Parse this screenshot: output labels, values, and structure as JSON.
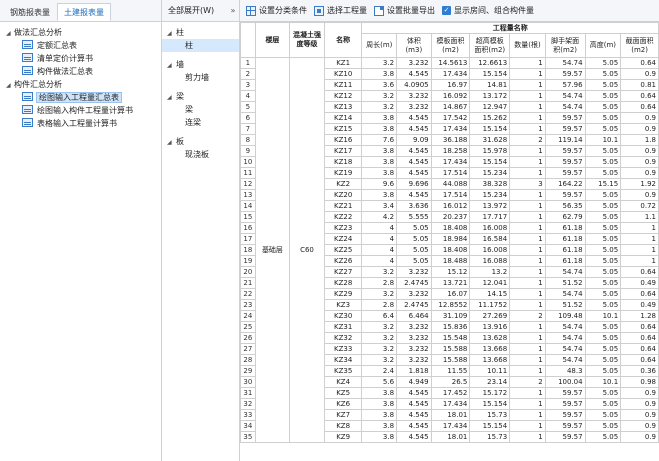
{
  "left_tabs": [
    "钢筋报表量",
    "土建报表量"
  ],
  "left_tree": [
    {
      "label": "做法汇总分析",
      "level": 0,
      "type": "folder"
    },
    {
      "label": "定额汇总表",
      "level": 1,
      "type": "report"
    },
    {
      "label": "清单定价计算书",
      "level": 1,
      "type": "report"
    },
    {
      "label": "构件做法汇总表",
      "level": 1,
      "type": "report"
    },
    {
      "label": "构件汇总分析",
      "level": 0,
      "type": "folder"
    },
    {
      "label": "绘图输入工程量汇总表",
      "level": 1,
      "type": "report",
      "selected": true
    },
    {
      "label": "绘图输入构件工程量计算书",
      "level": 1,
      "type": "report"
    },
    {
      "label": "表格输入工程量计算书",
      "level": 1,
      "type": "report"
    }
  ],
  "mid_header": {
    "dropdown": "全部展开(W)",
    "collapse": "»"
  },
  "mid_tree": [
    {
      "label": "柱",
      "kind": "cat"
    },
    {
      "label": "柱",
      "kind": "leaf",
      "selected": true
    },
    {
      "label": "",
      "kind": "gap"
    },
    {
      "label": "墙",
      "kind": "cat"
    },
    {
      "label": "剪力墙",
      "kind": "leaf"
    },
    {
      "label": "",
      "kind": "gap"
    },
    {
      "label": "梁",
      "kind": "cat"
    },
    {
      "label": "梁",
      "kind": "leaf"
    },
    {
      "label": "连梁",
      "kind": "leaf"
    },
    {
      "label": "",
      "kind": "gap"
    },
    {
      "label": "板",
      "kind": "cat"
    },
    {
      "label": "现浇板",
      "kind": "leaf"
    }
  ],
  "toolbar": {
    "set_category": "设置分类条件",
    "select_quantity": "选择工程量",
    "batch_export": "设置批量导出",
    "show_floor": "显示房间、组合构件量"
  },
  "table": {
    "group_header": "工程量名称",
    "headers": [
      "楼层",
      "混凝土强度等级",
      "名称",
      "周长(m)",
      "体积(m3)",
      "模板面积(m2)",
      "超高模板面积(m2)",
      "数量(根)",
      "脚手架面积(m2)",
      "高度(m)",
      "截面面积(m2)"
    ],
    "floor": "基础层",
    "grade": "C60",
    "rows": [
      [
        "KZ1",
        "3.2",
        "3.232",
        "14.5613",
        "12.6613",
        "1",
        "54.74",
        "5.05",
        "0.64"
      ],
      [
        "KZ10",
        "3.8",
        "4.545",
        "17.434",
        "15.154",
        "1",
        "59.57",
        "5.05",
        "0.9"
      ],
      [
        "KZ11",
        "3.6",
        "4.0905",
        "16.97",
        "14.81",
        "1",
        "57.96",
        "5.05",
        "0.81"
      ],
      [
        "KZ12",
        "3.2",
        "3.232",
        "16.092",
        "13.172",
        "1",
        "54.74",
        "5.05",
        "0.64"
      ],
      [
        "KZ13",
        "3.2",
        "3.232",
        "14.867",
        "12.947",
        "1",
        "54.74",
        "5.05",
        "0.64"
      ],
      [
        "KZ14",
        "3.8",
        "4.545",
        "17.542",
        "15.262",
        "1",
        "59.57",
        "5.05",
        "0.9"
      ],
      [
        "KZ15",
        "3.8",
        "4.545",
        "17.434",
        "15.154",
        "1",
        "59.57",
        "5.05",
        "0.9"
      ],
      [
        "KZ16",
        "7.6",
        "9.09",
        "36.188",
        "31.628",
        "2",
        "119.14",
        "10.1",
        "1.8"
      ],
      [
        "KZ17",
        "3.8",
        "4.545",
        "18.258",
        "15.978",
        "1",
        "59.57",
        "5.05",
        "0.9"
      ],
      [
        "KZ18",
        "3.8",
        "4.545",
        "17.434",
        "15.154",
        "1",
        "59.57",
        "5.05",
        "0.9"
      ],
      [
        "KZ19",
        "3.8",
        "4.545",
        "17.514",
        "15.234",
        "1",
        "59.57",
        "5.05",
        "0.9"
      ],
      [
        "KZ2",
        "9.6",
        "9.696",
        "44.088",
        "38.328",
        "3",
        "164.22",
        "15.15",
        "1.92"
      ],
      [
        "KZ20",
        "3.8",
        "4.545",
        "17.514",
        "15.234",
        "1",
        "59.57",
        "5.05",
        "0.9"
      ],
      [
        "KZ21",
        "3.4",
        "3.636",
        "16.012",
        "13.972",
        "1",
        "56.35",
        "5.05",
        "0.72"
      ],
      [
        "KZ22",
        "4.2",
        "5.555",
        "20.237",
        "17.717",
        "1",
        "62.79",
        "5.05",
        "1.1"
      ],
      [
        "KZ23",
        "4",
        "5.05",
        "18.408",
        "16.008",
        "1",
        "61.18",
        "5.05",
        "1"
      ],
      [
        "KZ24",
        "4",
        "5.05",
        "18.984",
        "16.584",
        "1",
        "61.18",
        "5.05",
        "1"
      ],
      [
        "KZ25",
        "4",
        "5.05",
        "18.408",
        "16.008",
        "1",
        "61.18",
        "5.05",
        "1"
      ],
      [
        "KZ26",
        "4",
        "5.05",
        "18.488",
        "16.088",
        "1",
        "61.18",
        "5.05",
        "1"
      ],
      [
        "KZ27",
        "3.2",
        "3.232",
        "15.12",
        "13.2",
        "1",
        "54.74",
        "5.05",
        "0.64"
      ],
      [
        "KZ28",
        "2.8",
        "2.4745",
        "13.721",
        "12.041",
        "1",
        "51.52",
        "5.05",
        "0.49"
      ],
      [
        "KZ29",
        "3.2",
        "3.232",
        "16.07",
        "14.15",
        "1",
        "54.74",
        "5.05",
        "0.64"
      ],
      [
        "KZ3",
        "2.8",
        "2.4745",
        "12.8552",
        "11.1752",
        "1",
        "51.52",
        "5.05",
        "0.49"
      ],
      [
        "KZ30",
        "6.4",
        "6.464",
        "31.109",
        "27.269",
        "2",
        "109.48",
        "10.1",
        "1.28"
      ],
      [
        "KZ31",
        "3.2",
        "3.232",
        "15.836",
        "13.916",
        "1",
        "54.74",
        "5.05",
        "0.64"
      ],
      [
        "KZ32",
        "3.2",
        "3.232",
        "15.548",
        "13.628",
        "1",
        "54.74",
        "5.05",
        "0.64"
      ],
      [
        "KZ33",
        "3.2",
        "3.232",
        "15.588",
        "13.668",
        "1",
        "54.74",
        "5.05",
        "0.64"
      ],
      [
        "KZ34",
        "3.2",
        "3.232",
        "15.588",
        "13.668",
        "1",
        "54.74",
        "5.05",
        "0.64"
      ],
      [
        "KZ35",
        "2.4",
        "1.818",
        "11.55",
        "10.11",
        "1",
        "48.3",
        "5.05",
        "0.36"
      ],
      [
        "KZ4",
        "5.6",
        "4.949",
        "26.5",
        "23.14",
        "2",
        "100.04",
        "10.1",
        "0.98"
      ],
      [
        "KZ5",
        "3.8",
        "4.545",
        "17.452",
        "15.172",
        "1",
        "59.57",
        "5.05",
        "0.9"
      ],
      [
        "KZ6",
        "3.8",
        "4.545",
        "17.434",
        "15.154",
        "1",
        "59.57",
        "5.05",
        "0.9"
      ],
      [
        "KZ7",
        "3.8",
        "4.545",
        "18.01",
        "15.73",
        "1",
        "59.57",
        "5.05",
        "0.9"
      ],
      [
        "KZ8",
        "3.8",
        "4.545",
        "17.434",
        "15.154",
        "1",
        "59.57",
        "5.05",
        "0.9"
      ],
      [
        "KZ9",
        "3.8",
        "4.545",
        "18.01",
        "15.73",
        "1",
        "59.57",
        "5.05",
        "0.9"
      ]
    ]
  }
}
